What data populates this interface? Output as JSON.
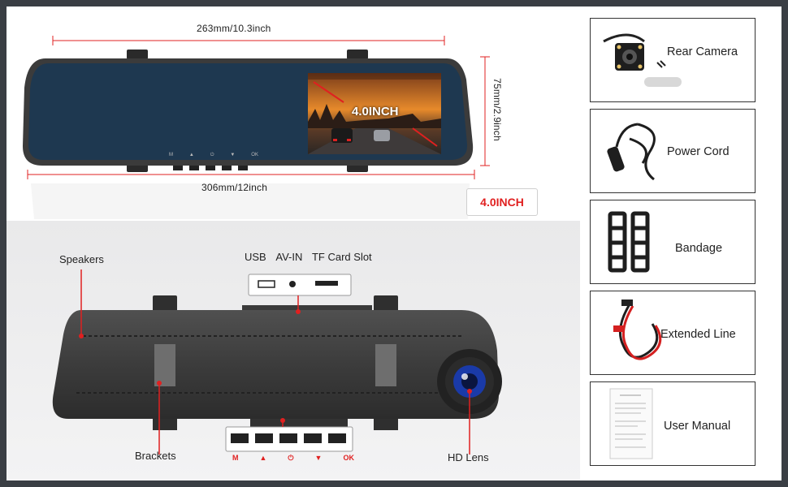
{
  "top_diagram": {
    "width_top_label": "263mm/10.3inch",
    "width_bottom_label": "306mm/12inch",
    "height_label": "75mm/2.9inch",
    "screen_text": "4.0INCH",
    "mirror_buttons": [
      "M",
      "▲",
      "⏻",
      "▼",
      "OK"
    ]
  },
  "badge": {
    "text": "4.0INCH"
  },
  "back_diagram": {
    "speakers": "Speakers",
    "brackets": "Brackets",
    "hd_lens": "HD Lens",
    "ports": [
      "USB",
      "AV-IN",
      "TF Card Slot"
    ],
    "button_labels": [
      "M",
      "▲",
      "⏻",
      "▼",
      "OK"
    ]
  },
  "accessories": [
    {
      "label": "Rear Camera",
      "icon": "rear-camera-icon"
    },
    {
      "label": "Power Cord",
      "icon": "power-cord-icon"
    },
    {
      "label": "Bandage",
      "icon": "bandage-icon"
    },
    {
      "label": "Extended Line",
      "icon": "extension-cable-icon"
    },
    {
      "label": "User Manual",
      "icon": "manual-icon"
    }
  ],
  "colors": {
    "accent_red": "#e02020",
    "screen_blue": "#1e3850"
  }
}
